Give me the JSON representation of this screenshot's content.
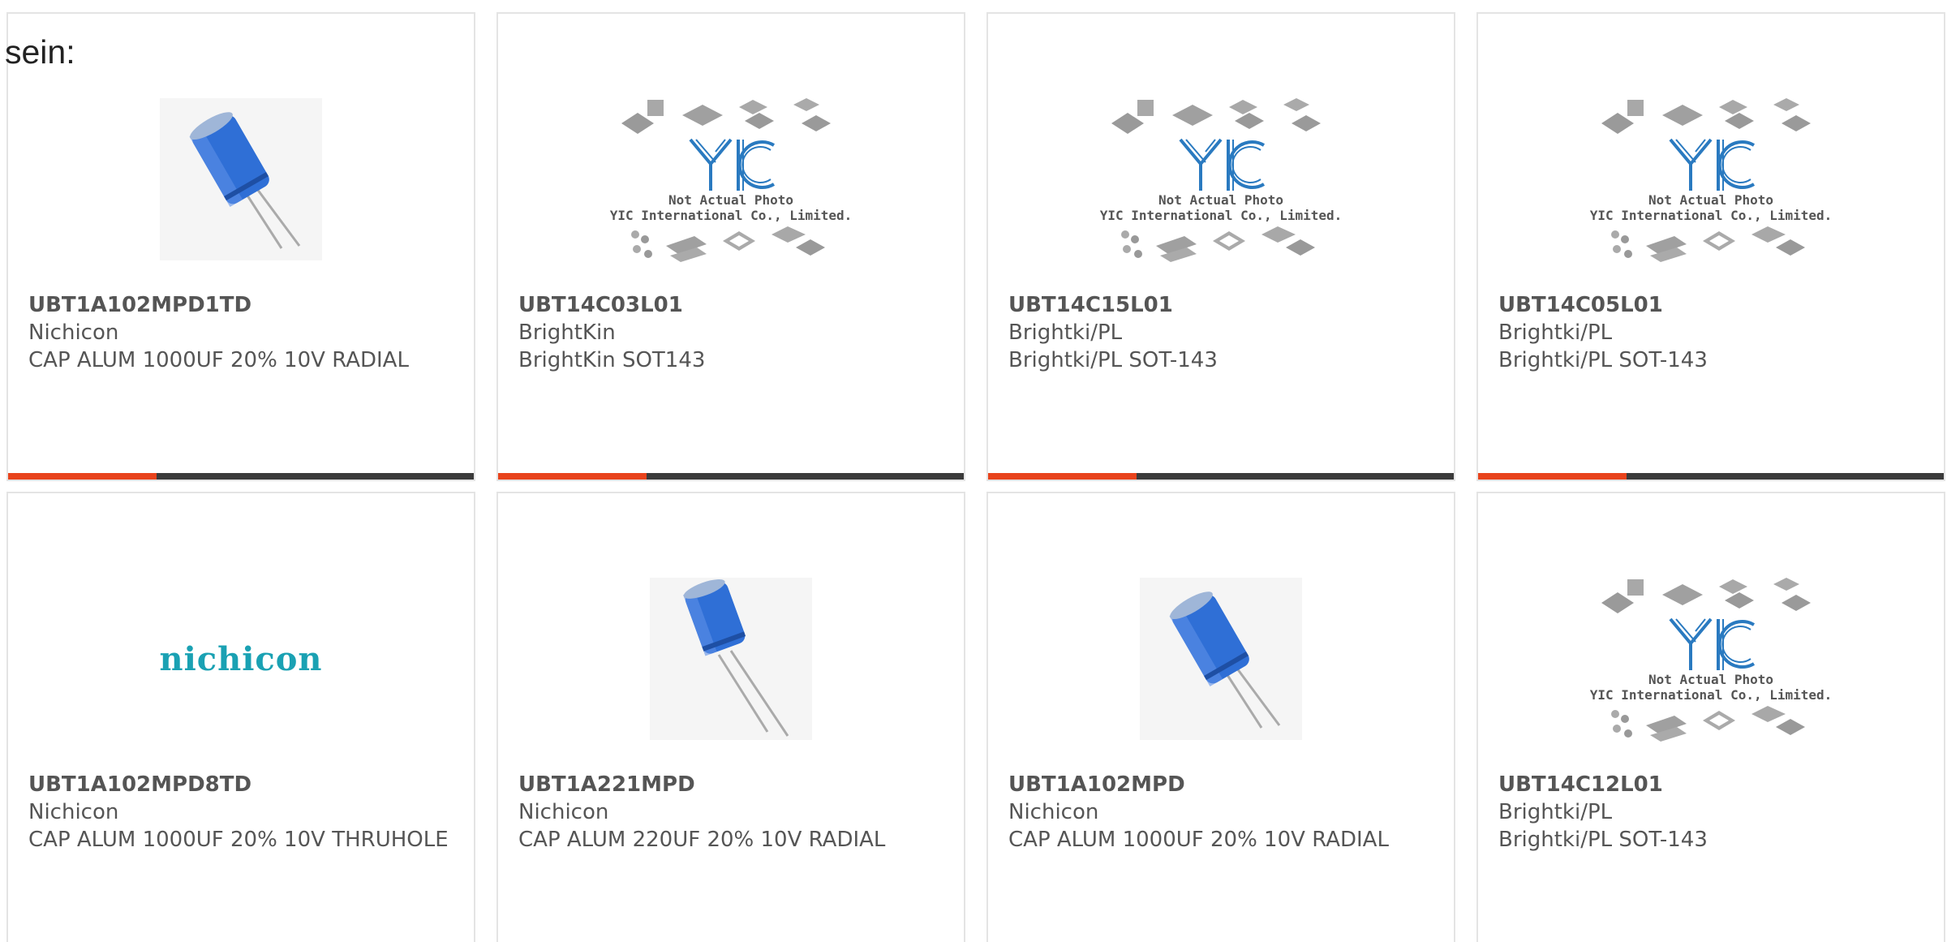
{
  "page": {
    "lead_text": "sein:"
  },
  "colors": {
    "accent": "#e8431c",
    "bar": "#3b3b3b",
    "logo": "#1aa1b3",
    "cap_blue": "#2f6fd6"
  },
  "products": [
    {
      "part": "UBT1A102MPD1TD",
      "brand": "Nichicon",
      "desc": "CAP ALUM 1000UF 20% 10V RADIAL",
      "image": "capacitor-photo",
      "accent_bar": true
    },
    {
      "part": "UBT14C03L01",
      "brand": "BrightKin",
      "desc": "BrightKin SOT143",
      "image": "yic-placeholder",
      "accent_bar": true
    },
    {
      "part": "UBT14C15L01",
      "brand": "Brightki/PL",
      "desc": "Brightki/PL SOT-143",
      "image": "yic-placeholder",
      "accent_bar": true
    },
    {
      "part": "UBT14C05L01",
      "brand": "Brightki/PL",
      "desc": "Brightki/PL SOT-143",
      "image": "yic-placeholder",
      "accent_bar": true
    },
    {
      "part": "UBT1A102MPD8TD",
      "brand": "Nichicon",
      "desc": "CAP ALUM 1000UF 20% 10V THRUHOLE",
      "image": "nichicon-logo",
      "accent_bar": false
    },
    {
      "part": "UBT1A221MPD",
      "brand": "Nichicon",
      "desc": "CAP ALUM 220UF 20% 10V RADIAL",
      "image": "capacitor-photo-long",
      "accent_bar": false
    },
    {
      "part": "UBT1A102MPD",
      "brand": "Nichicon",
      "desc": "CAP ALUM 1000UF 20% 10V RADIAL",
      "image": "capacitor-photo",
      "accent_bar": false
    },
    {
      "part": "UBT14C12L01",
      "brand": "Brightki/PL",
      "desc": "Brightki/PL SOT-143",
      "image": "yic-placeholder",
      "accent_bar": false
    }
  ],
  "placeholder": {
    "logo_text": "YIC",
    "line1": "Not Actual Photo",
    "line2": "YIC International Co., Limited."
  },
  "nichicon_logo_text": "nichicon"
}
